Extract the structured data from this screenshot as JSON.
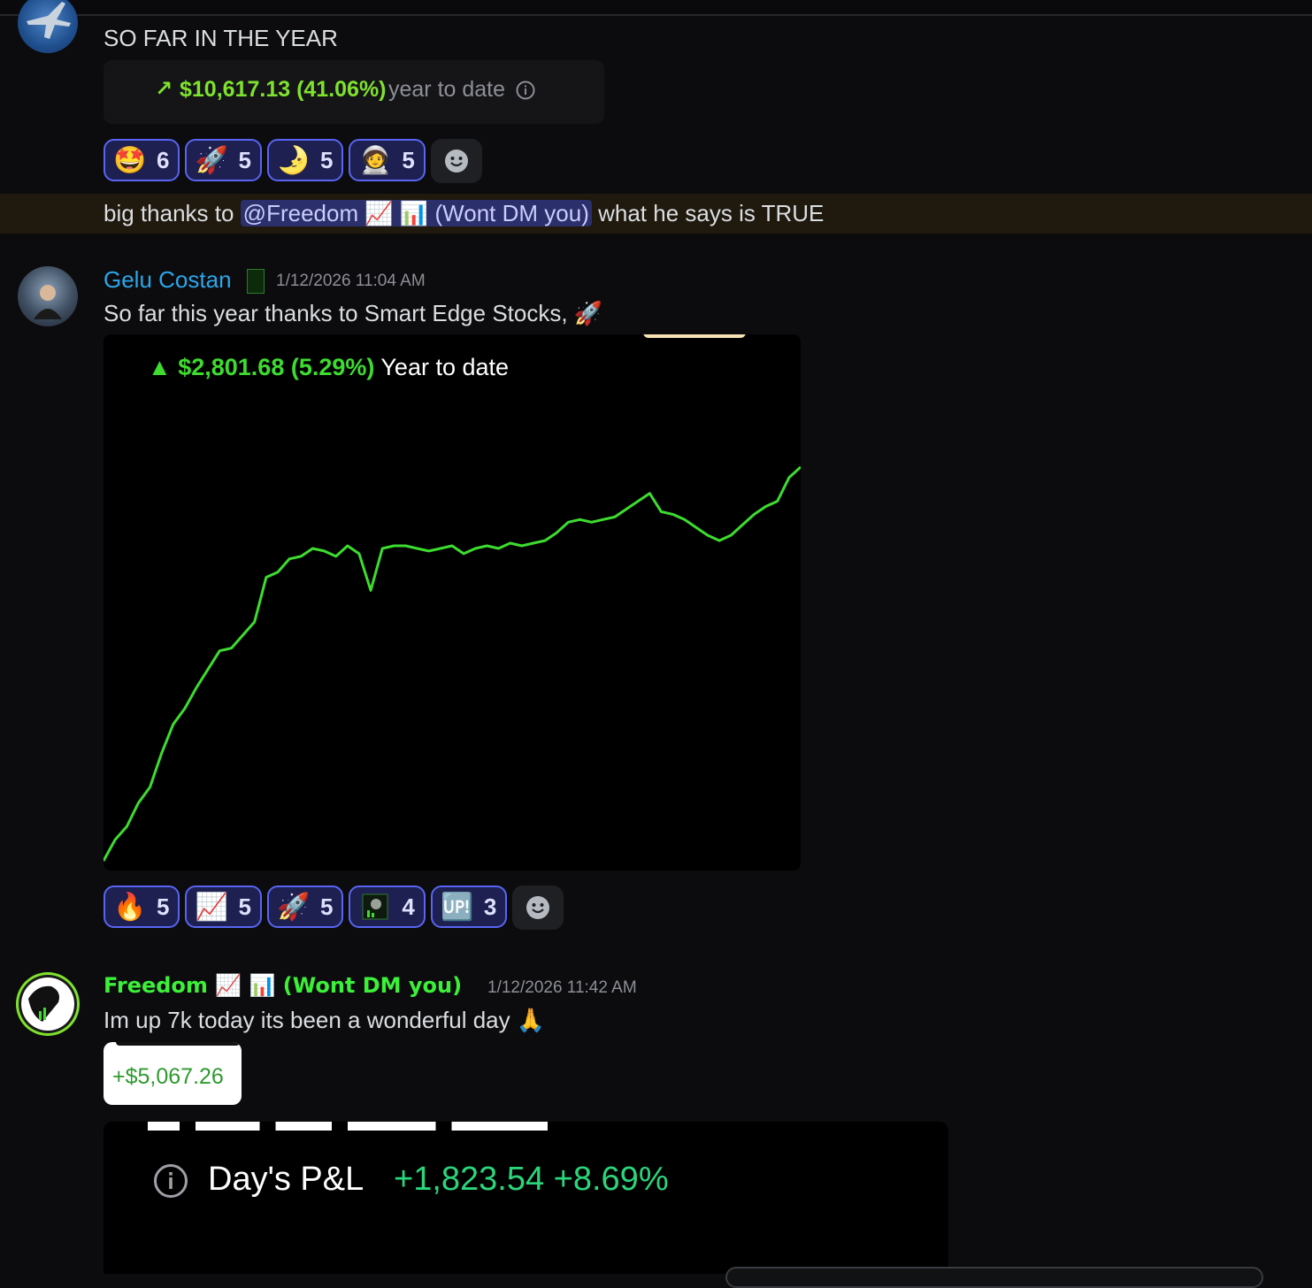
{
  "messages": [
    {
      "text": "SO FAR IN THE YEAR",
      "embed": {
        "arrow": "↗",
        "amount": "$10,617.13 (41.06%)",
        "label": "year to date",
        "info_icon": "info-icon"
      },
      "reactions": [
        {
          "emoji": "🤩",
          "count": "6"
        },
        {
          "emoji": "🚀",
          "count": "5"
        },
        {
          "emoji": "🌛",
          "count": "5"
        },
        {
          "emoji": "🧑‍🚀",
          "count": "5"
        }
      ]
    },
    {
      "prefix": "big thanks to",
      "mention": "@Freedom 📈 📊 (Wont DM you)",
      "suffix": "what he says is TRUE"
    },
    {
      "author": "Gelu Costan",
      "timestamp": "1/12/2026 11:04 AM",
      "text": "So far this year thanks to Smart Edge Stocks, 🚀",
      "reactions": [
        {
          "emoji": "🔥",
          "count": "5"
        },
        {
          "emoji": "📈",
          "count": "5"
        },
        {
          "emoji": "🚀",
          "count": "5"
        },
        {
          "emoji": "server-emoji",
          "count": "4"
        },
        {
          "emoji": "🆙",
          "count": "3"
        }
      ]
    },
    {
      "author": "Freedom 📈 📊 (Wont DM you)",
      "timestamp": "1/12/2026 11:42 AM",
      "text": "Im up 7k today its been a wonderful day 🙏",
      "card_value": "+$5,067.26",
      "pnl": {
        "label": "Day's P&L",
        "value": "+1,823.54 +8.69%"
      }
    }
  ],
  "chart_data": {
    "type": "line",
    "title": "▲ $2,801.68 (5.29%) Year to date",
    "title_value": "▲ $2,801.68 (5.29%)",
    "title_label": "Year to date",
    "x": [
      0,
      1,
      2,
      3,
      4,
      5,
      6,
      7,
      8,
      9,
      10,
      11,
      12,
      13,
      14,
      15,
      16,
      17,
      18,
      19,
      20,
      21,
      22,
      23,
      24,
      25,
      26,
      27,
      28,
      29,
      30,
      31,
      32,
      33,
      34,
      35,
      36,
      37,
      38,
      39,
      40,
      41,
      42,
      43,
      44,
      45,
      46,
      47,
      48,
      49,
      50,
      51,
      52,
      53,
      54,
      55,
      56,
      57,
      58,
      59,
      60
    ],
    "values": [
      0.0,
      0.8,
      1.3,
      2.2,
      2.8,
      4.1,
      5.2,
      5.8,
      6.6,
      7.3,
      8.0,
      8.1,
      8.6,
      9.1,
      10.8,
      11.0,
      11.5,
      11.6,
      11.9,
      11.8,
      11.6,
      12.0,
      11.7,
      10.3,
      11.9,
      12.0,
      12.0,
      11.9,
      11.8,
      11.9,
      12.0,
      11.7,
      11.9,
      12.0,
      11.9,
      12.1,
      12.0,
      12.1,
      12.2,
      12.5,
      12.9,
      13.0,
      12.9,
      13.0,
      13.1,
      13.4,
      13.7,
      14.0,
      13.3,
      13.2,
      13.0,
      12.7,
      12.4,
      12.2,
      12.4,
      12.8,
      13.2,
      13.5,
      13.7,
      14.6,
      15.0
    ],
    "color": "#3ddc2f",
    "grid": false,
    "axes": false
  },
  "colors": {
    "green": "#7fe22d",
    "chart_green": "#3ddc2f",
    "author_blue": "#2aa7ea",
    "author_green": "#3cf039",
    "mention_bg": "#2b2f6b",
    "reaction_border": "#5865f2"
  }
}
